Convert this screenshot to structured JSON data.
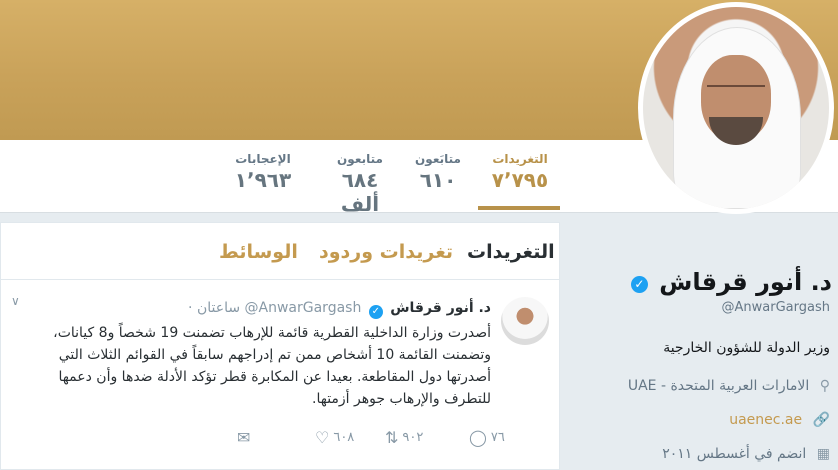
{
  "stats": {
    "tweets": {
      "label": "التغريدات",
      "value": "٧٬٧٩٥"
    },
    "following": {
      "label": "متابَعون",
      "value": "٦١٠"
    },
    "followers": {
      "label": "متابعون",
      "value": "٦٨٤ ألف"
    },
    "likes": {
      "label": "الإعجابات",
      "value": "١٬٩٦٣"
    }
  },
  "tabs": {
    "tweets": "التغريدات",
    "tweets_replies": "تغريدات وردود",
    "media": "الوسائط"
  },
  "tweet": {
    "name": "د. أنور قرقاش",
    "handle": "@AnwarGargash",
    "time": "· ساعتان",
    "text": "أصدرت وزارة الداخلية القطرية قائمة للإرهاب تضمنت 19 شخصاً و8 كيانات، وتضمنت القائمة 10 أشخاص ممن تم إدراجهم سابقاً في القوائم الثلاث التي أصدرتها دول المقاطعة. بعيدا عن المكابرة قطر تؤكد الأدلة ضدها وأن دعمها للتطرف والإرهاب جوهر أزمتها.",
    "replies": "٧٦",
    "retweets": "٩٠٢",
    "likes": "٦٠٨"
  },
  "profile": {
    "name": "د. أنور قرقاش",
    "handle": "@AnwarGargash",
    "bio": "وزير الدولة للشؤون الخارجية",
    "location": "UAE - الامارات العربية المتحدة",
    "website": "uaenec.ae",
    "joined": "انضم في أغسطس ٢٠١١"
  },
  "icons": {
    "reply": "speech-bubble-icon",
    "retweet": "retweet-arrows-icon",
    "like": "heart-icon",
    "dm": "envelope-icon",
    "location": "map-pin-icon",
    "link": "link-icon",
    "calendar": "calendar-icon",
    "verified": "verified-badge-icon"
  },
  "colors": {
    "accent": "#c49a4f",
    "banner": "#c9a25a",
    "verified": "#1da1f2"
  }
}
